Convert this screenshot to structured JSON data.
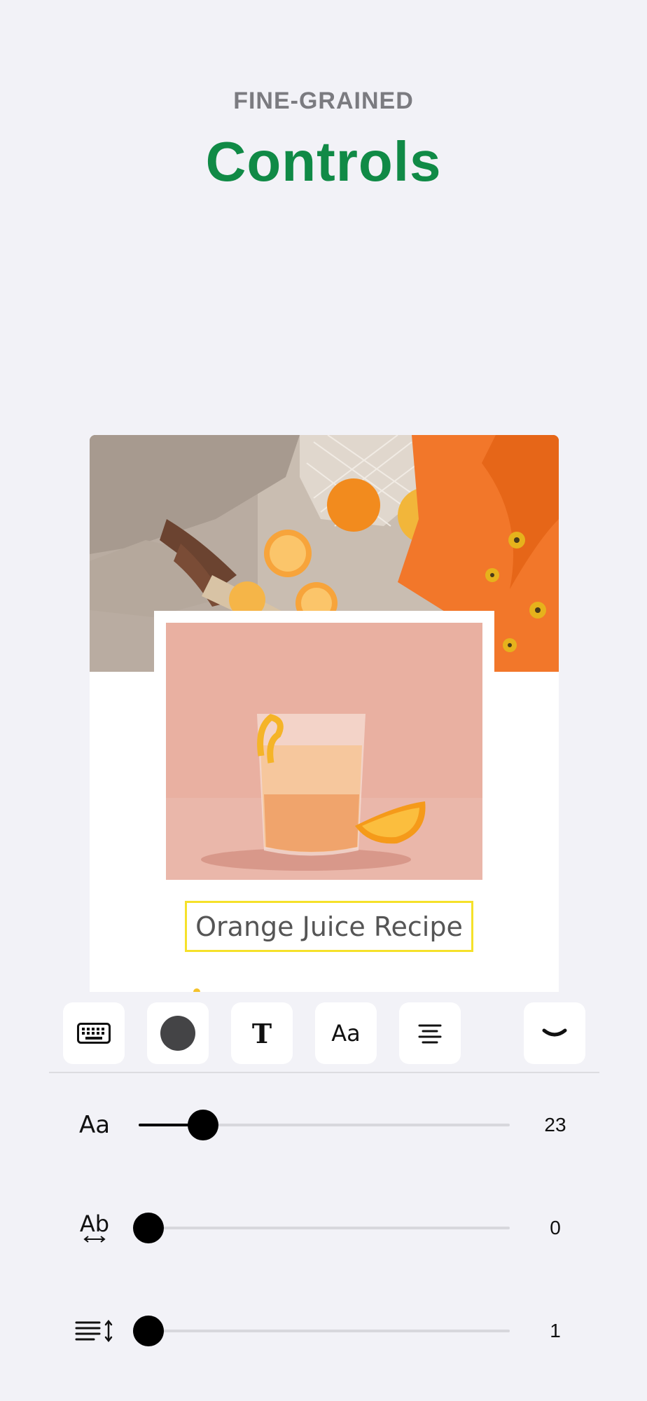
{
  "header": {
    "eyebrow": "FINE-GRAINED",
    "title": "Controls"
  },
  "canvas": {
    "text_layer": "Orange Juice Recipe"
  },
  "toolbar": {
    "buttons": [
      {
        "id": "keyboard",
        "icon": "keyboard-icon"
      },
      {
        "id": "text-color",
        "icon": "color-swatch-icon",
        "color": "#444446"
      },
      {
        "id": "font-family",
        "icon": "serif-t-icon",
        "glyph": "T"
      },
      {
        "id": "font-size",
        "icon": "text-size-icon",
        "glyph": "Aa"
      },
      {
        "id": "alignment",
        "icon": "align-center-icon"
      },
      {
        "id": "collapse",
        "icon": "chevron-down-icon"
      }
    ]
  },
  "controls": {
    "font_size": {
      "icon": "text-size-icon",
      "label": "Aa",
      "value": "23",
      "fraction": 0.17
    },
    "letter_spacing": {
      "icon": "letter-spacing-icon",
      "label": "Ab",
      "value": "0",
      "fraction": 0.0
    },
    "line_height": {
      "icon": "line-height-icon",
      "value": "1",
      "fraction": 0.0
    }
  },
  "colors": {
    "accent_green": "#108a46",
    "selection_yellow": "#f5e12a",
    "background": "#f2f2f7"
  }
}
